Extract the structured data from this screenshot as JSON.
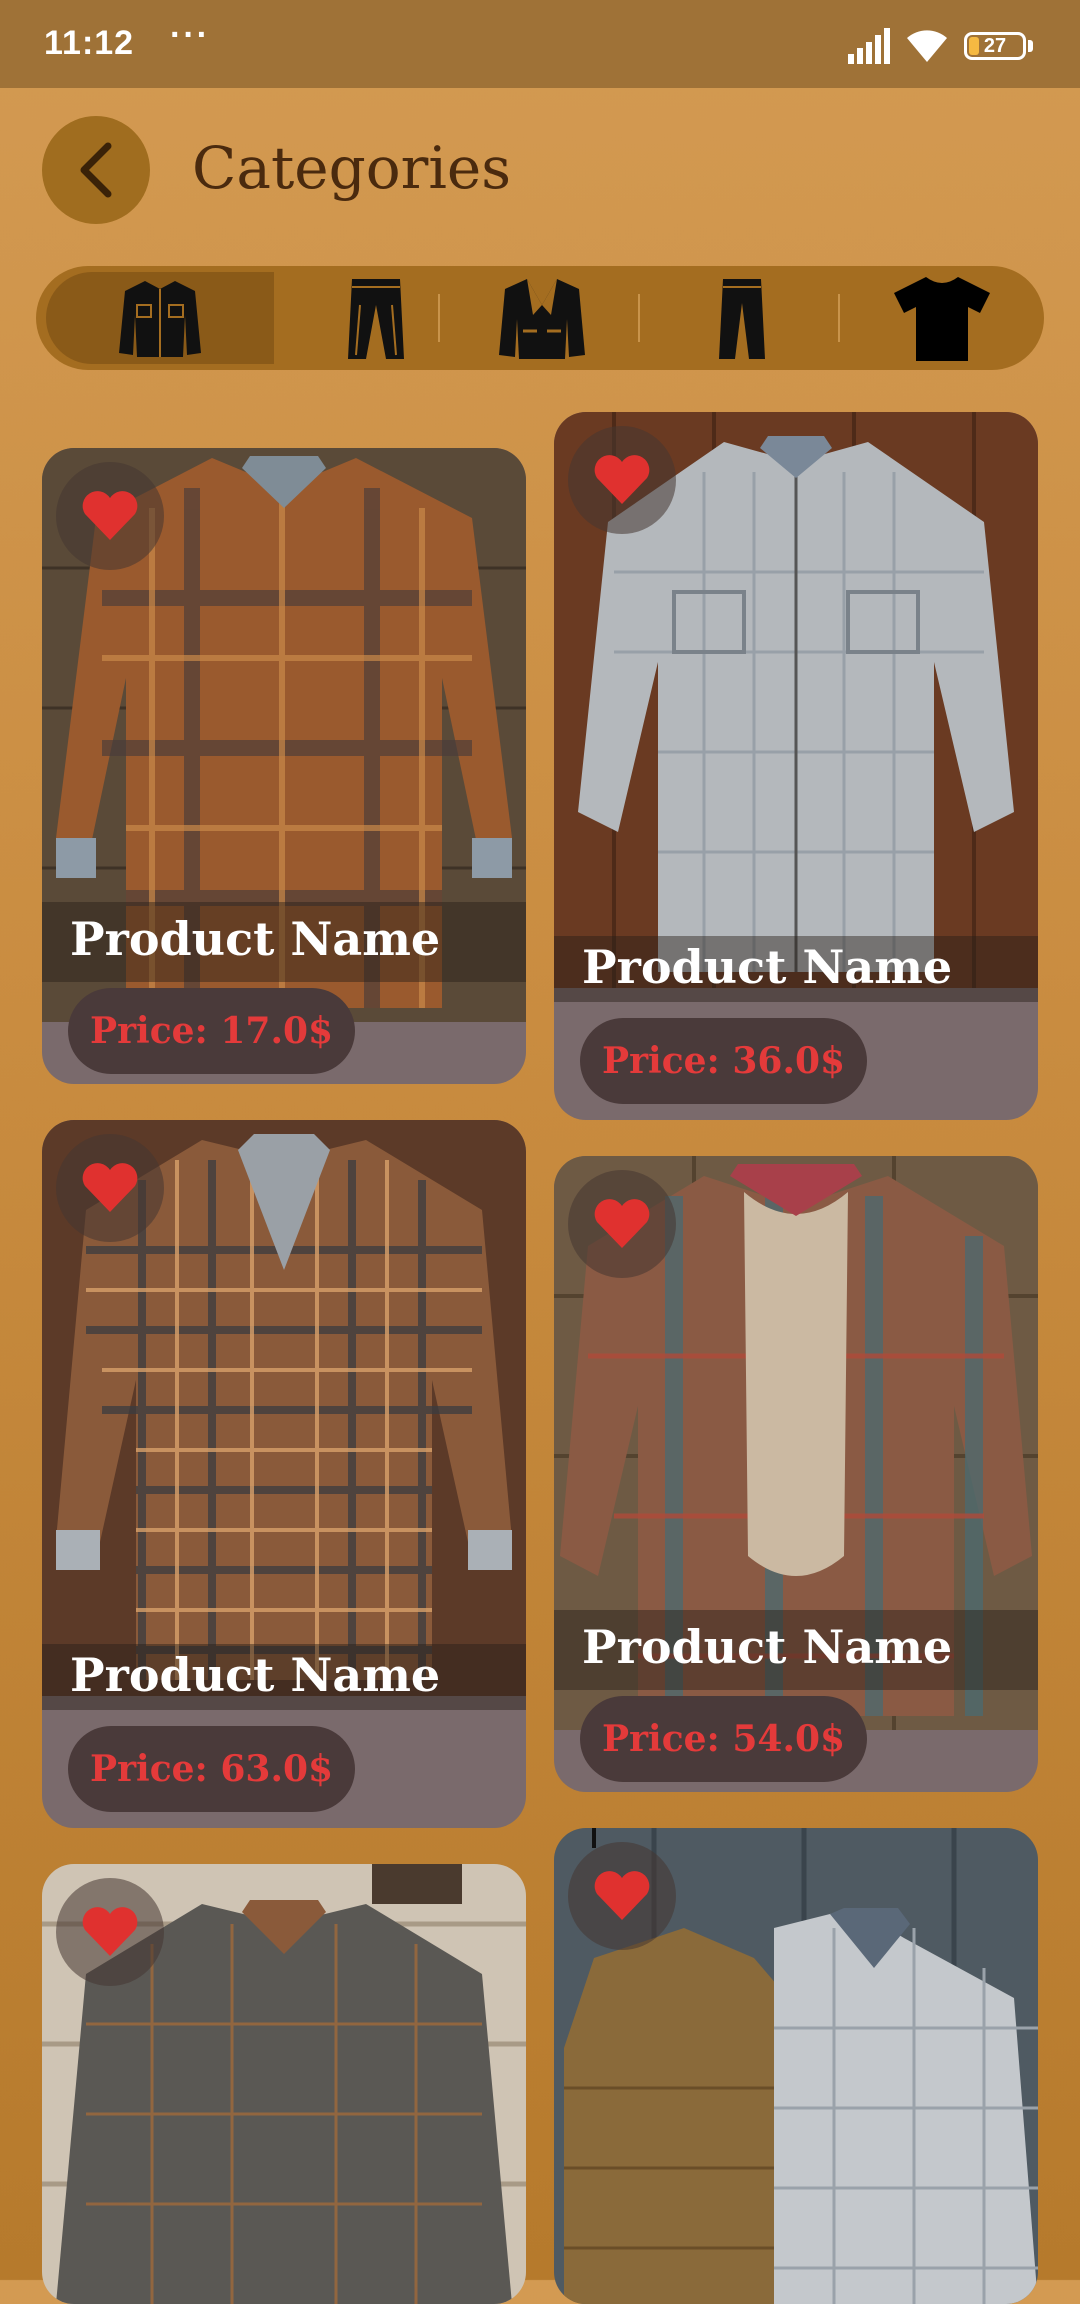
{
  "status_bar": {
    "time": "11:12",
    "dots": "···",
    "battery": "27"
  },
  "header": {
    "title": "Categories"
  },
  "categories": [
    {
      "icon": "jacket-icon",
      "selected": true
    },
    {
      "icon": "jeans-icon",
      "selected": false
    },
    {
      "icon": "blazer-icon",
      "selected": false
    },
    {
      "icon": "pants-icon",
      "selected": false
    },
    {
      "icon": "tshirt-icon",
      "selected": false
    }
  ],
  "products": [
    {
      "name": "Product Name",
      "price": "Price: 17.0$",
      "favorite": true
    },
    {
      "name": "Product Name",
      "price": "Price: 36.0$",
      "favorite": true
    },
    {
      "name": "Product Name",
      "price": "Price: 63.0$",
      "favorite": true
    },
    {
      "name": "Product Name",
      "price": "Price: 54.0$",
      "favorite": true
    },
    {
      "name": "",
      "price": "",
      "favorite": true
    },
    {
      "name": "",
      "price": "",
      "favorite": true
    }
  ],
  "colors": {
    "background": "#c98c40",
    "accent_dark": "#4a2a0e",
    "heart": "#e0312f",
    "price_text": "#e43a3a"
  }
}
